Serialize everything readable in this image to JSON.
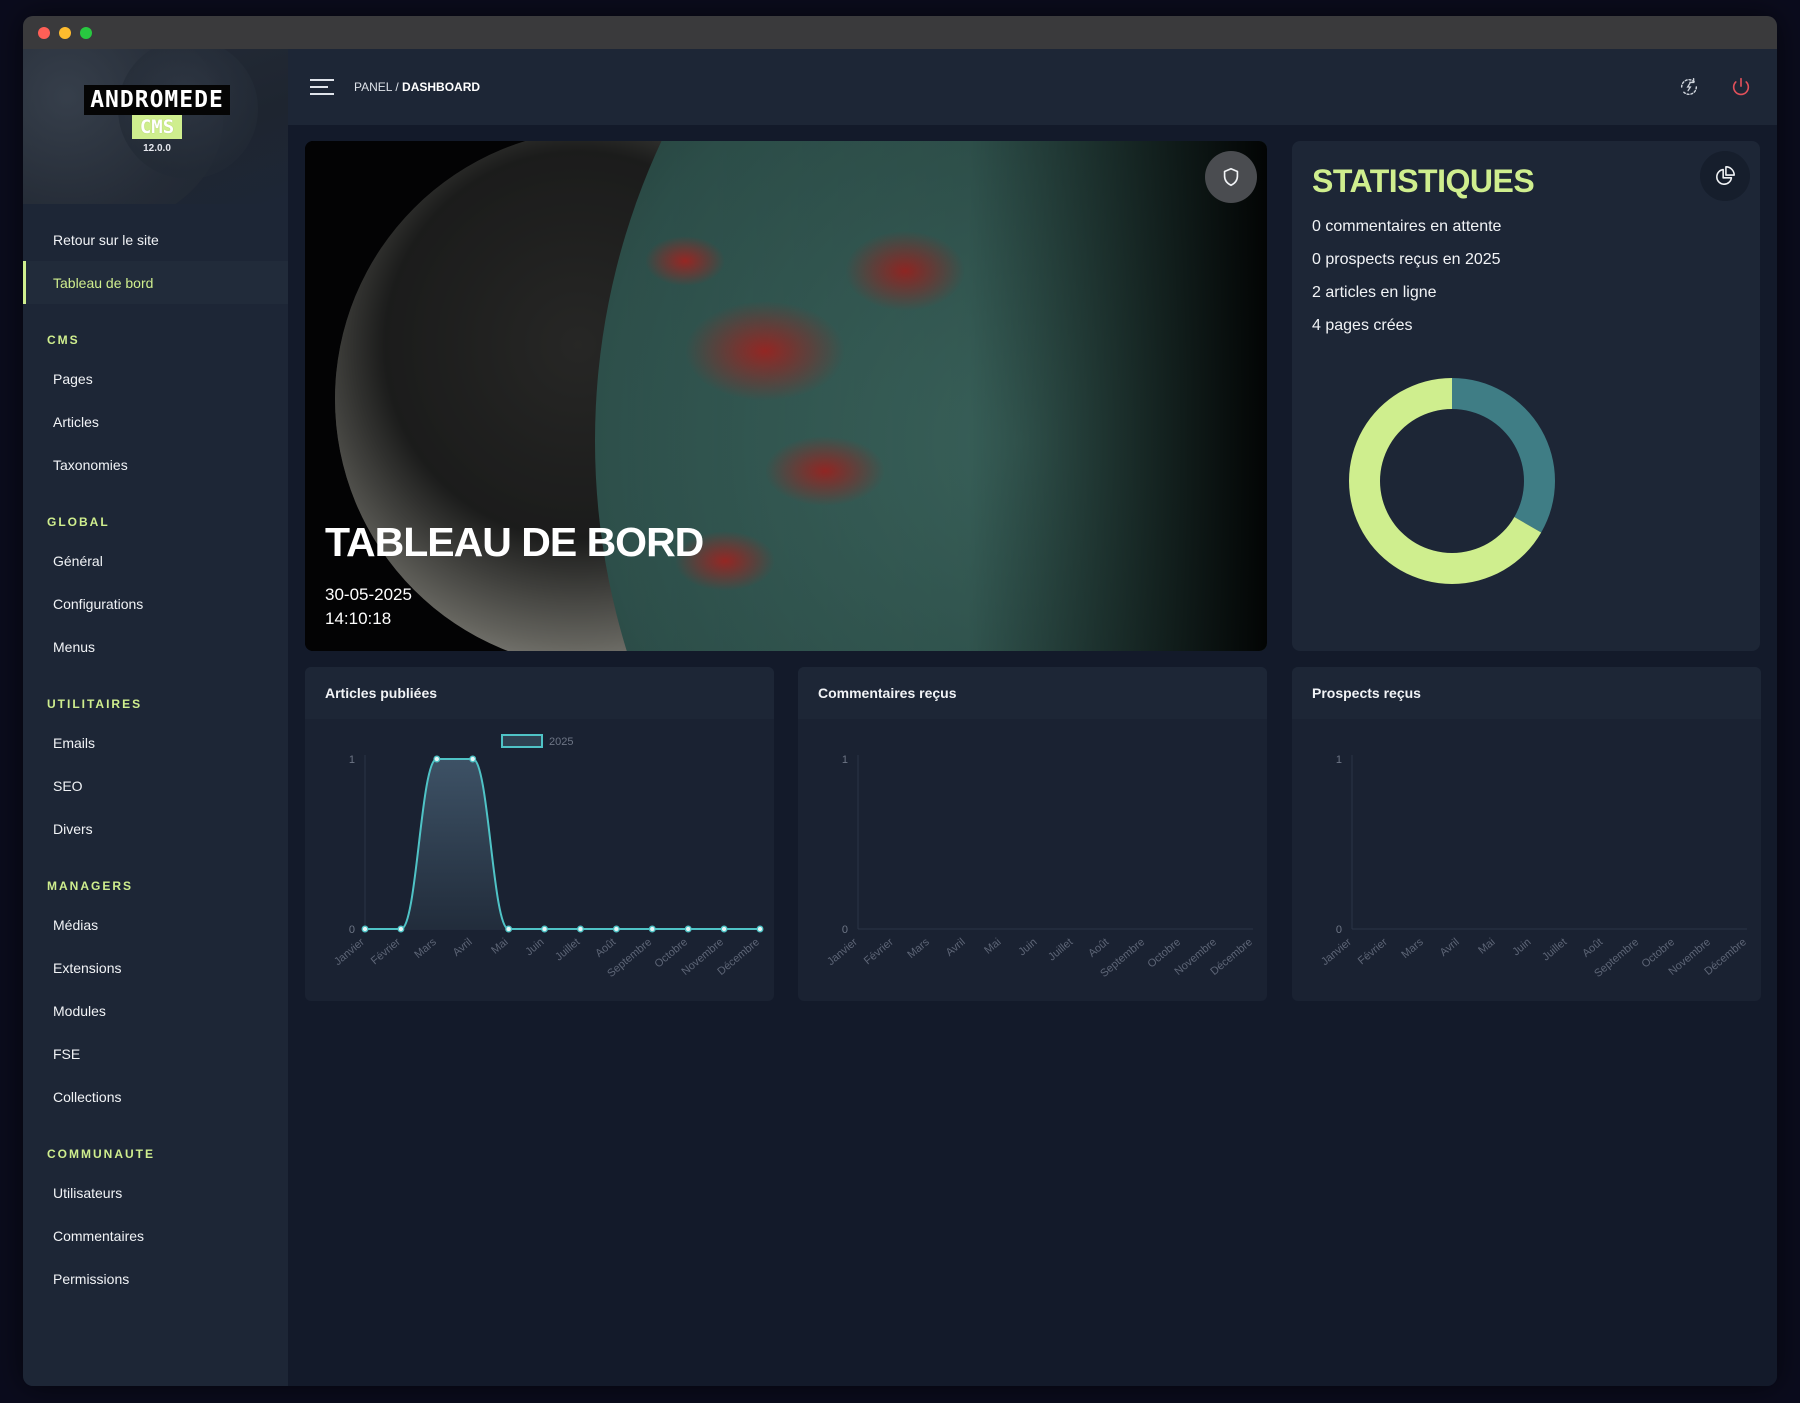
{
  "window": {
    "controls": [
      "close",
      "minimize",
      "maximize"
    ]
  },
  "brand": {
    "name": "ANDROMEDE",
    "product": "CMS",
    "version": "12.0.0"
  },
  "sidebar": {
    "top_items": [
      {
        "label": "Retour sur le site",
        "active": false
      },
      {
        "label": "Tableau de bord",
        "active": true
      }
    ],
    "sections": [
      {
        "title": "CMS",
        "items": [
          "Pages",
          "Articles",
          "Taxonomies"
        ]
      },
      {
        "title": "GLOBAL",
        "items": [
          "Général",
          "Configurations",
          "Menus"
        ]
      },
      {
        "title": "UTILITAIRES",
        "items": [
          "Emails",
          "SEO",
          "Divers"
        ]
      },
      {
        "title": "MANAGERS",
        "items": [
          "Médias",
          "Extensions",
          "Modules",
          "FSE",
          "Collections"
        ]
      },
      {
        "title": "COMMUNAUTE",
        "items": [
          "Utilisateurs",
          "Commentaires",
          "Permissions"
        ]
      }
    ]
  },
  "topbar": {
    "breadcrumb_root": "PANEL",
    "breadcrumb_separator": " / ",
    "breadcrumb_current": "DASHBOARD",
    "icons": [
      "menu-icon",
      "refresh-icon",
      "power-icon"
    ]
  },
  "hero": {
    "title": "TABLEAU DE BORD",
    "date": "30-05-2025",
    "time": "14:10:18",
    "badge_icon": "shield-icon"
  },
  "stats": {
    "title": "STATISTIQUES",
    "lines": [
      "0 commentaires en attente",
      "0 prospects reçus en 2025",
      "2 articles en ligne",
      "4 pages crées"
    ],
    "icon": "pie-chart-icon"
  },
  "colors": {
    "accent": "#cfee8e",
    "teal": "#3f7d85",
    "line": "#4fc3c6",
    "sidebar_bg": "#1d2636",
    "main_bg": "#131a2a",
    "power_red": "#e0505a"
  },
  "chart_data": [
    {
      "type": "pie",
      "title": "",
      "categories": [
        "",
        ""
      ],
      "values": [
        2,
        4
      ],
      "colors": [
        "#3f7d85",
        "#cfee8e"
      ],
      "donut": true
    },
    {
      "type": "area",
      "title": "Articles publiées",
      "categories": [
        "Janvier",
        "Février",
        "Mars",
        "Avril",
        "Mai",
        "Juin",
        "Juillet",
        "Août",
        "Septembre",
        "Octobre",
        "Novembre",
        "Décembre"
      ],
      "series": [
        {
          "name": "2025",
          "values": [
            0,
            0,
            1,
            1,
            0,
            0,
            0,
            0,
            0,
            0,
            0,
            0
          ]
        }
      ],
      "ylim": [
        0,
        1
      ],
      "yticks": [
        "1",
        "0"
      ],
      "legend": "top-center"
    },
    {
      "type": "line",
      "title": "Commentaires reçus",
      "categories": [
        "Janvier",
        "Février",
        "Mars",
        "Avril",
        "Mai",
        "Juin",
        "Juillet",
        "Août",
        "Septembre",
        "Octobre",
        "Novembre",
        "Décembre"
      ],
      "series": [],
      "ylim": [
        0,
        1
      ],
      "yticks": [
        "1",
        "0"
      ]
    },
    {
      "type": "line",
      "title": "Prospects reçus",
      "categories": [
        "Janvier",
        "Février",
        "Mars",
        "Avril",
        "Mai",
        "Juin",
        "Juillet",
        "Août",
        "Septembre",
        "Octobre",
        "Novembre",
        "Décembre"
      ],
      "series": [],
      "ylim": [
        0,
        1
      ],
      "yticks": [
        "1",
        "0"
      ]
    }
  ]
}
